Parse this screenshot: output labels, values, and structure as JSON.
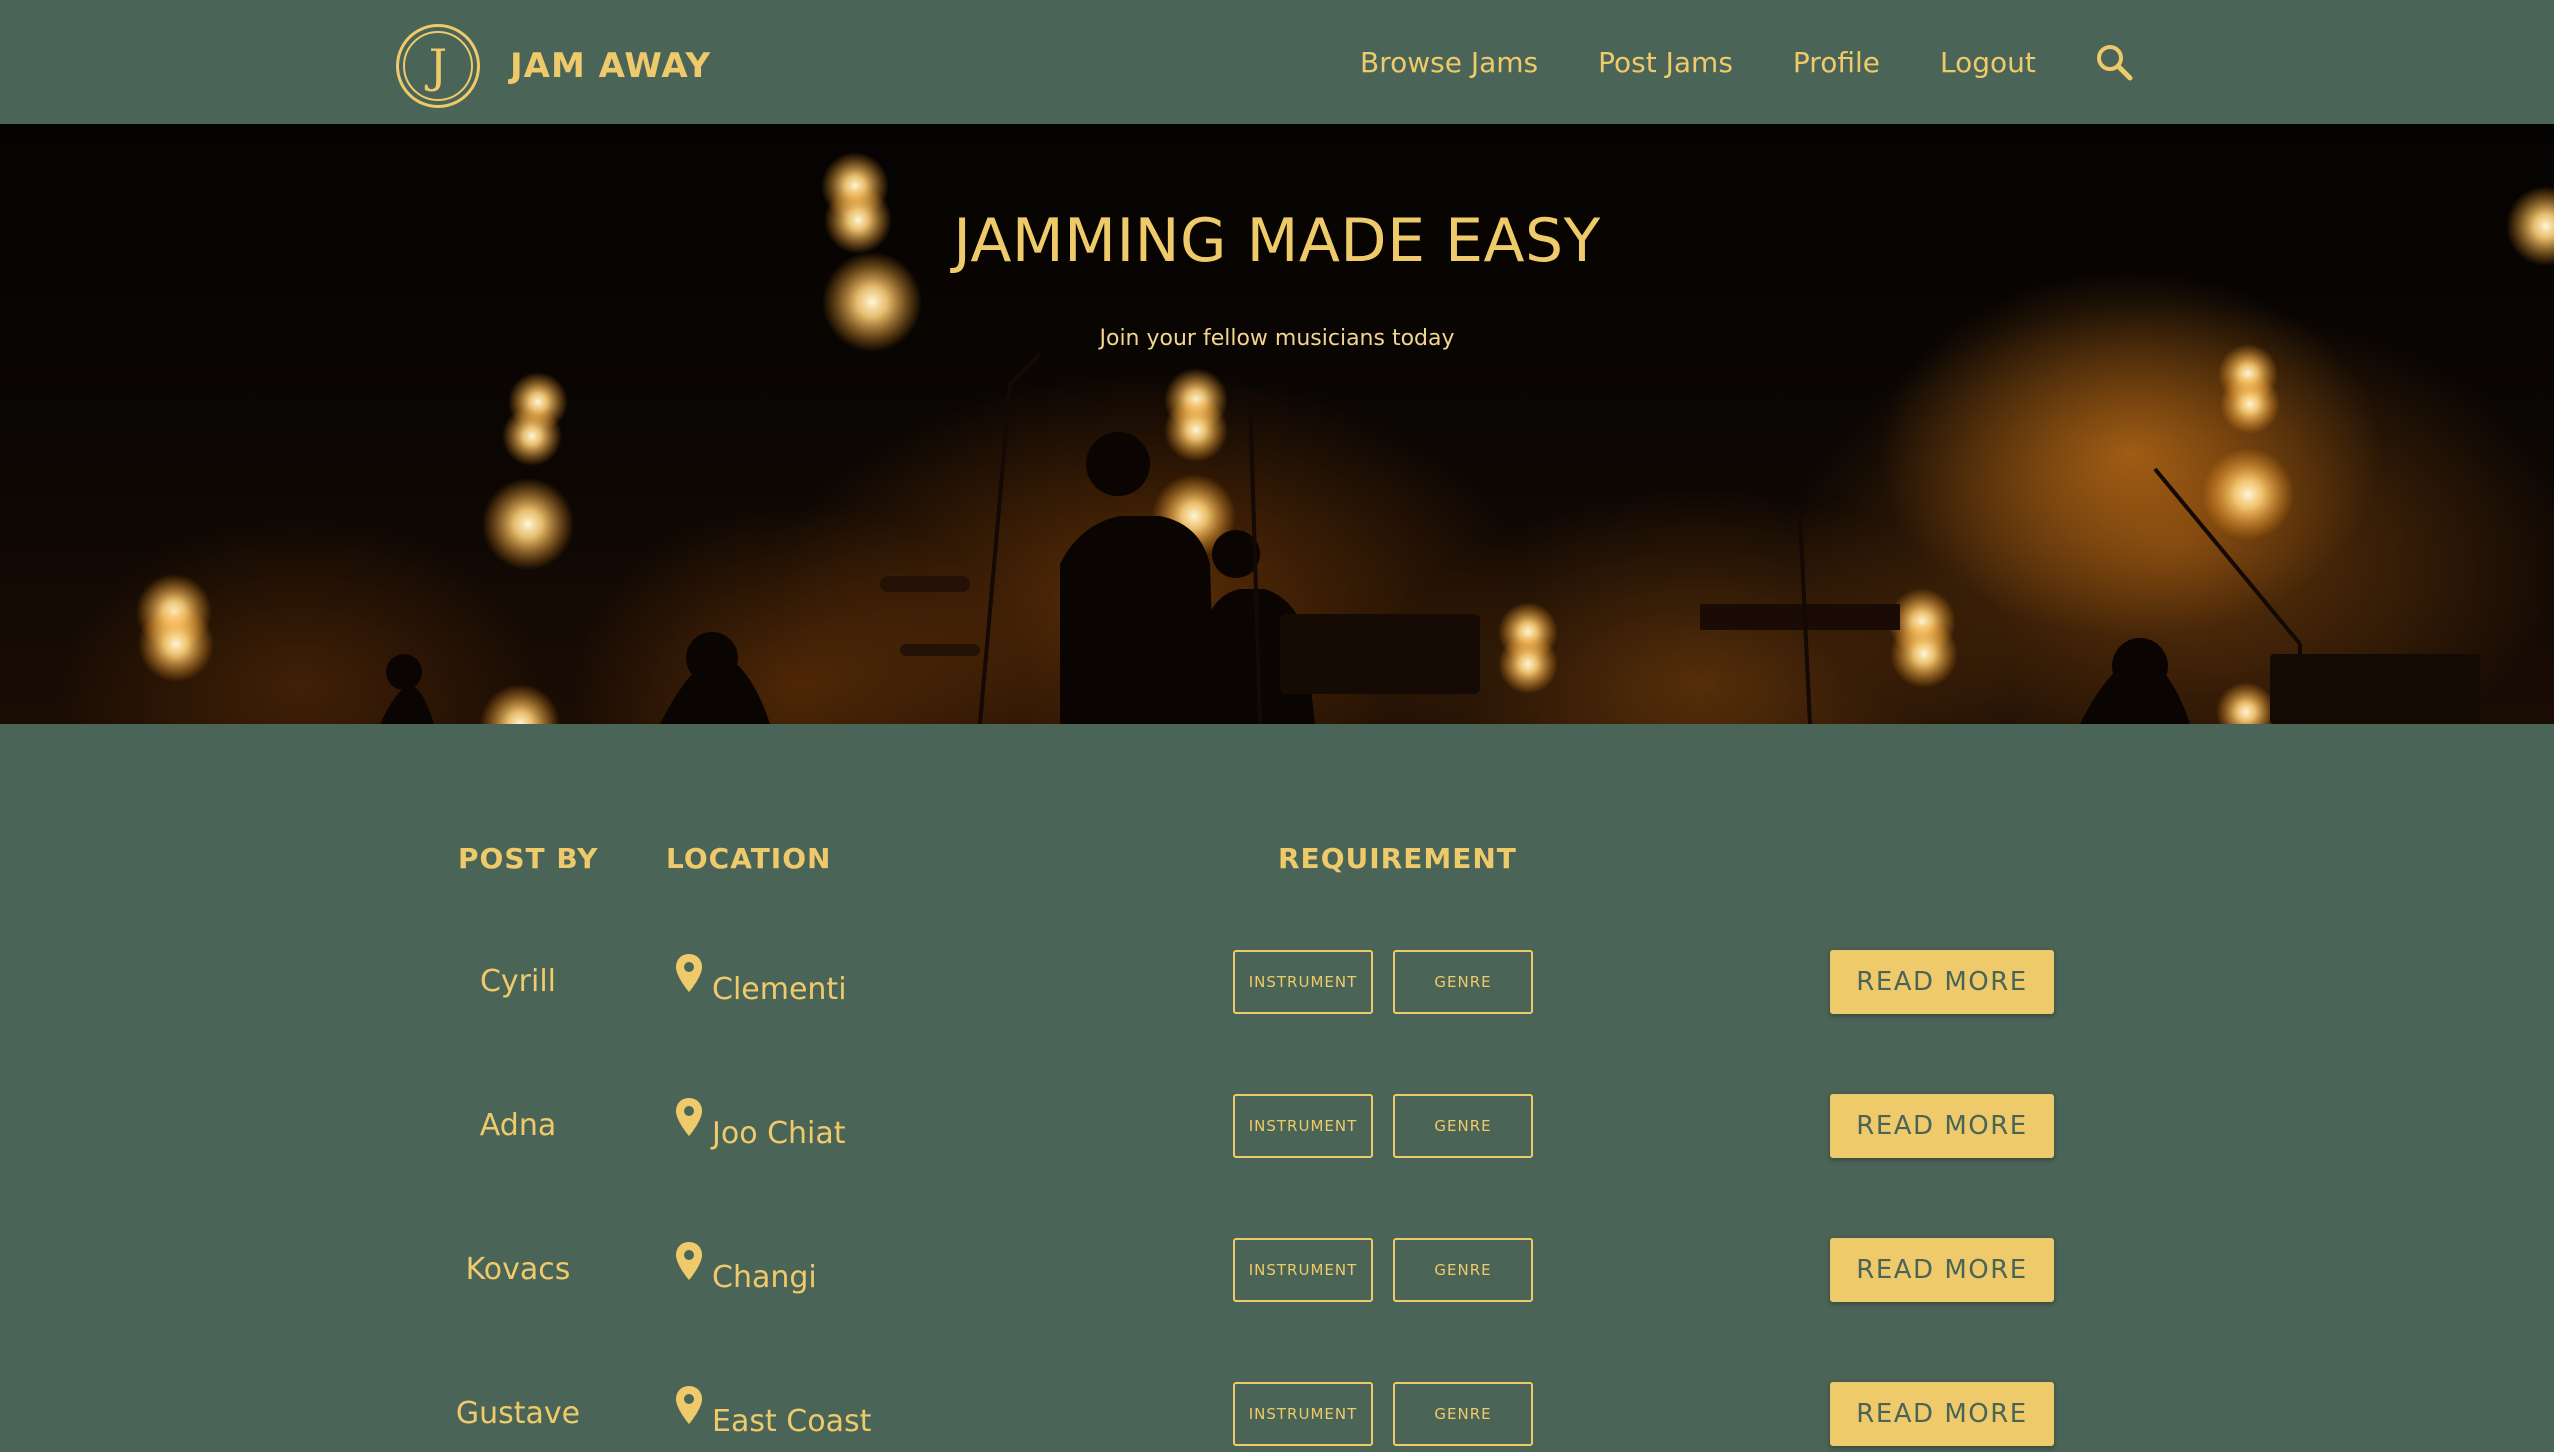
{
  "colors": {
    "background": "#4a6557",
    "accent": "#efca6a",
    "button_text": "#4a6557"
  },
  "brand": {
    "logo_letter": "J",
    "name": "JAM AWAY"
  },
  "nav": {
    "items": [
      {
        "label": "Browse Jams"
      },
      {
        "label": "Post Jams"
      },
      {
        "label": "Profile"
      },
      {
        "label": "Logout"
      }
    ],
    "search_icon": "search-icon"
  },
  "hero": {
    "title": "JAMMING MADE EASY",
    "subtitle": "Join your fellow musicians today",
    "background": "concert stage photo"
  },
  "listing": {
    "headers": {
      "post_by": "POST BY",
      "location": "LOCATION",
      "requirement": "REQUIREMENT"
    },
    "rows": [
      {
        "post_by": "Cyrill",
        "location": "Clementi",
        "tag1": "INSTRUMENT",
        "tag2": "GENRE",
        "action": "READ MORE"
      },
      {
        "post_by": "Adna",
        "location": "Joo Chiat",
        "tag1": "INSTRUMENT",
        "tag2": "GENRE",
        "action": "READ MORE"
      },
      {
        "post_by": "Kovacs",
        "location": "Changi",
        "tag1": "INSTRUMENT",
        "tag2": "GENRE",
        "action": "READ MORE"
      },
      {
        "post_by": "Gustave",
        "location": "East Coast",
        "tag1": "INSTRUMENT",
        "tag2": "GENRE",
        "action": "READ MORE"
      }
    ],
    "location_icon": "map-pin-icon"
  }
}
